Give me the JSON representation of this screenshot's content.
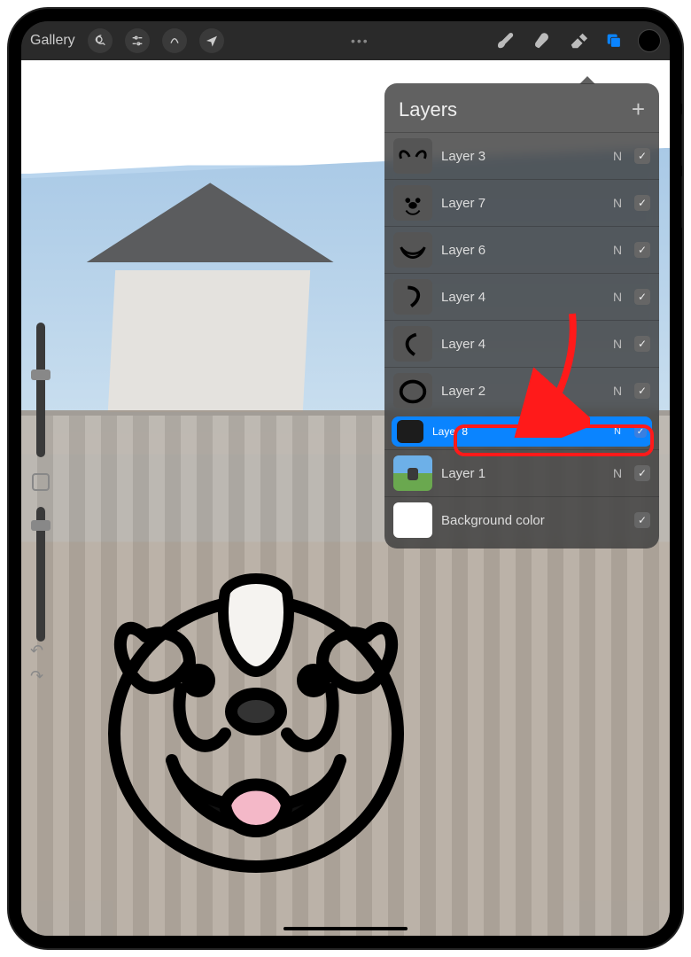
{
  "toolbar": {
    "gallery_label": "Gallery"
  },
  "layers_panel": {
    "title": "Layers",
    "rows": [
      {
        "name": "Layer 3",
        "blend": "N",
        "visible": true,
        "selected": false,
        "thumb": "ears"
      },
      {
        "name": "Layer 7",
        "blend": "N",
        "visible": true,
        "selected": false,
        "thumb": "face"
      },
      {
        "name": "Layer 6",
        "blend": "N",
        "visible": true,
        "selected": false,
        "thumb": "mouth"
      },
      {
        "name": "Layer 4",
        "blend": "N",
        "visible": true,
        "selected": false,
        "thumb": "curve1"
      },
      {
        "name": "Layer 4",
        "blend": "N",
        "visible": true,
        "selected": false,
        "thumb": "curve2"
      },
      {
        "name": "Layer 2",
        "blend": "N",
        "visible": true,
        "selected": false,
        "thumb": "circle"
      },
      {
        "name": "Layer 8",
        "blend": "N",
        "visible": true,
        "selected": true,
        "thumb": "dark"
      },
      {
        "name": "Layer 1",
        "blend": "N",
        "visible": true,
        "selected": false,
        "thumb": "photo"
      },
      {
        "name": "Background color",
        "blend": "",
        "visible": true,
        "selected": false,
        "thumb": "white"
      }
    ]
  },
  "annotation": {
    "highlighted_layer_index": 6
  }
}
